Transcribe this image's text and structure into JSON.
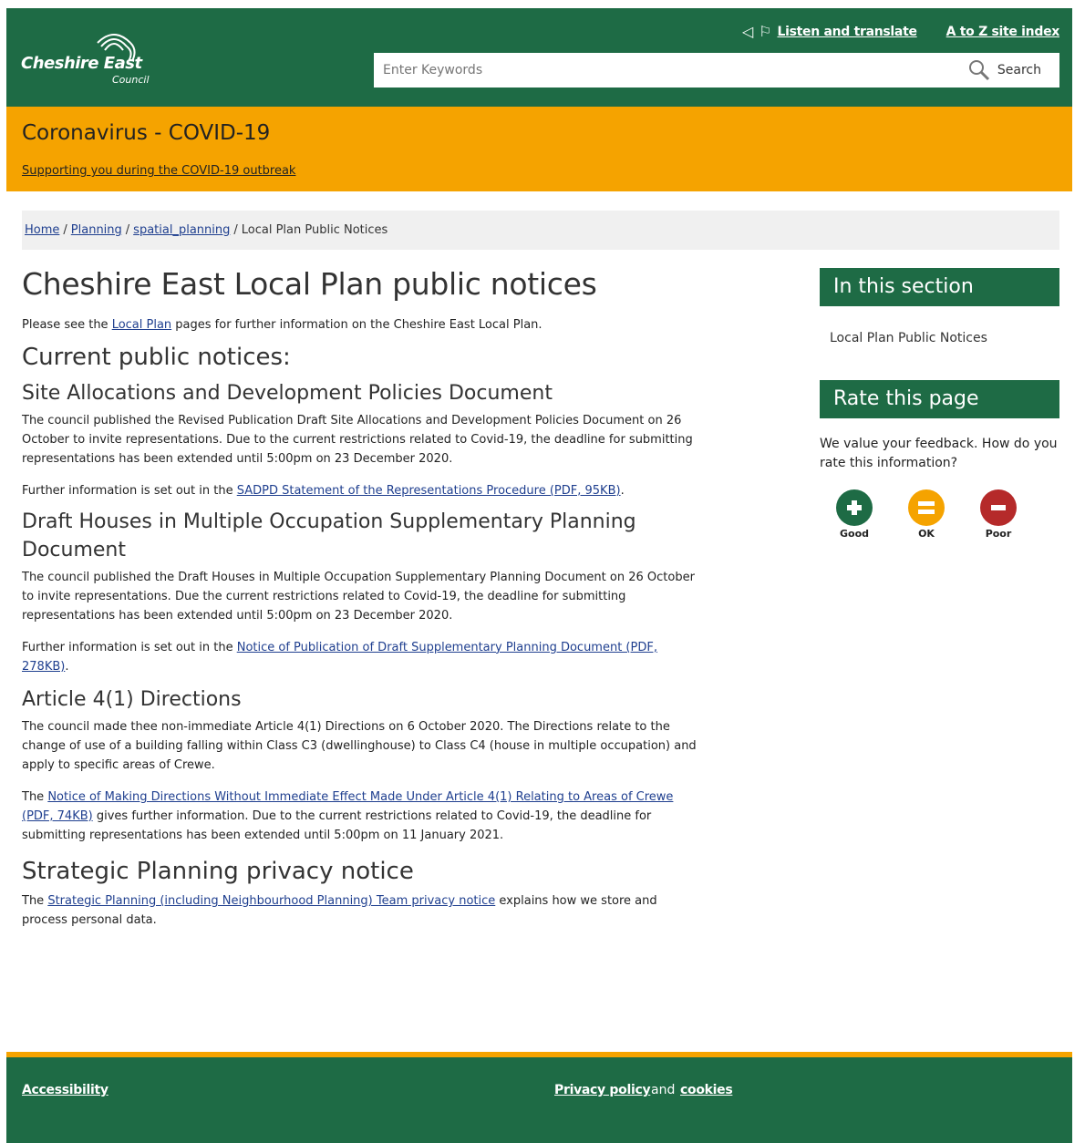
{
  "header": {
    "logo_name": "Cheshire East",
    "logo_sub": "Council",
    "listen_label": "Listen and translate",
    "az_label": "A to Z site index",
    "search_placeholder": "Enter Keywords",
    "search_button": "Search"
  },
  "banner": {
    "title": "Coronavirus - COVID-19",
    "link": "Supporting you during the COVID-19 outbreak"
  },
  "breadcrumb": {
    "items": [
      "Home",
      "Planning",
      "spatial_planning"
    ],
    "separator": "/",
    "current": "Local Plan Public Notices"
  },
  "main": {
    "title": "Cheshire East Local Plan public notices",
    "intro_pre": "Please see the ",
    "intro_link": "Local Plan",
    "intro_post": " pages for further information on the Cheshire East Local Plan.",
    "current_heading": "Current public notices:",
    "sadpd": {
      "heading": "Site Allocations and Development Policies Document",
      "body": "The council published the Revised Publication Draft Site Allocations and Development Policies Document on 26 October to invite representations. Due to the current restrictions related to Covid-19, the deadline for submitting representations has been extended until 5:00pm on 23 December 2020.",
      "further_pre": "Further information is set out in the ",
      "further_link": "SADPD Statement of the Representations Procedure (PDF, 95KB)",
      "further_post": "."
    },
    "hmo": {
      "heading": "Draft Houses in Multiple Occupation Supplementary Planning Document",
      "body": "The council published the Draft Houses in Multiple Occupation Supplementary Planning Document on 26 October to invite representations. Due the current restrictions related to Covid-19, the deadline for submitting representations has been extended until 5:00pm on 23 December 2020.",
      "further_pre": "Further information is set out in the ",
      "further_link": "Notice of Publication of Draft Supplementary Planning Document (PDF, 278KB)",
      "further_post": "."
    },
    "article4": {
      "heading": "Article 4(1) Directions",
      "body": "The council made thee non-immediate Article 4(1) Directions on 6 October 2020. The Directions relate to the change of use of a building falling within Class C3 (dwellinghouse) to Class C4 (house in multiple occupation) and apply to specific areas of Crewe.",
      "notice_pre": "The ",
      "notice_link": "Notice of Making Directions Without Immediate Effect Made Under Article 4(1) Relating to Areas of Crewe (PDF, 74KB)",
      "notice_post": " gives further information. Due to the current restrictions related to Covid-19, the deadline for submitting representations has been extended until 5:00pm on 11 January 2021."
    },
    "privacy": {
      "heading": "Strategic Planning privacy notice",
      "pre": "The ",
      "link": "Strategic Planning (including Neighbourhood Planning) Team privacy notice",
      "post": " explains how we store and process personal data."
    }
  },
  "sidebar": {
    "section_title": "In this section",
    "section_link": "Local Plan Public Notices",
    "rate_title": "Rate this page",
    "rate_text": "We value your feedback. How do you rate this information?",
    "ratings": [
      {
        "label": "Good",
        "color": "#1e6b45"
      },
      {
        "label": "OK",
        "color": "#f5a300"
      },
      {
        "label": "Poor",
        "color": "#b52a2a"
      }
    ]
  },
  "footer": {
    "accessibility": "Accessibility",
    "privacy": "Privacy policy",
    "and": "and",
    "cookies": "cookies"
  }
}
